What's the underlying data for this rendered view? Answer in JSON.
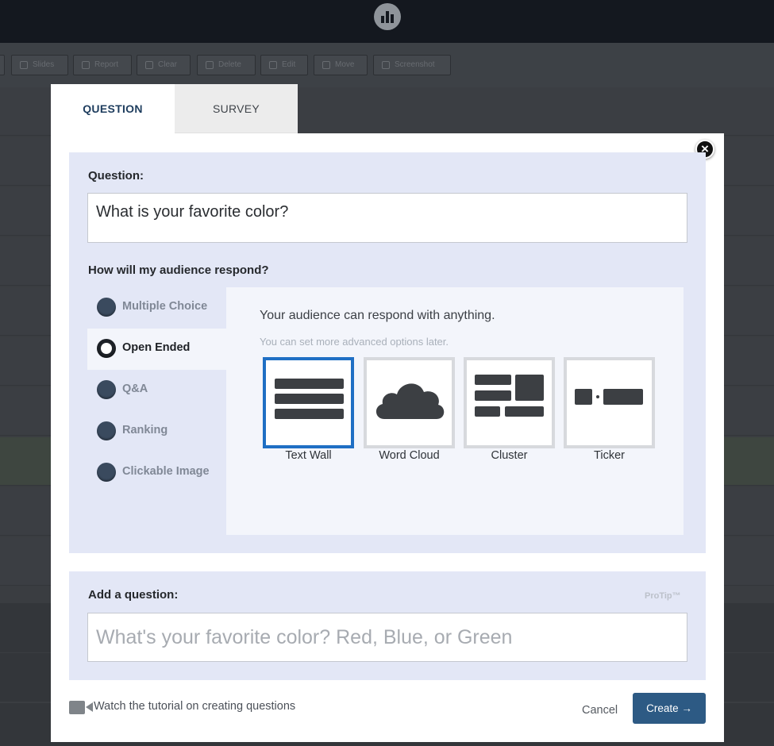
{
  "toolbar": {
    "buttons": [
      {
        "label": "Slides",
        "icon": "link-icon"
      },
      {
        "label": "Report",
        "icon": "report-icon"
      },
      {
        "label": "Clear",
        "icon": "clear-icon"
      },
      {
        "label": "Delete",
        "icon": "trash-icon"
      },
      {
        "label": "Edit",
        "icon": "pencil-icon"
      },
      {
        "label": "Move",
        "icon": "move-icon"
      },
      {
        "label": "Screenshot",
        "icon": "camera-icon"
      }
    ]
  },
  "modal": {
    "tabs": [
      {
        "label": "QUESTION",
        "active": true
      },
      {
        "label": "SURVEY",
        "active": false
      }
    ],
    "close_icon": "×",
    "question": {
      "label": "Question:",
      "value": "What is your favorite color?"
    },
    "respond": {
      "label": "How will my audience respond?",
      "types": [
        {
          "label": "Multiple Choice",
          "selected": false
        },
        {
          "label": "Open Ended",
          "selected": true
        },
        {
          "label": "Q&A",
          "selected": false
        },
        {
          "label": "Ranking",
          "selected": false
        },
        {
          "label": "Clickable Image",
          "selected": false
        }
      ],
      "headline": "Your audience can respond with anything.",
      "subline": "You can set more advanced options later.",
      "visualizations": [
        {
          "label": "Text Wall",
          "icon": "text-wall-icon",
          "selected": true
        },
        {
          "label": "Word Cloud",
          "icon": "cloud-icon",
          "selected": false
        },
        {
          "label": "Cluster",
          "icon": "cluster-icon",
          "selected": false
        },
        {
          "label": "Ticker",
          "icon": "ticker-icon",
          "selected": false
        }
      ]
    },
    "add_question": {
      "label": "Add a question:",
      "protip": "ProTip™",
      "placeholder": "What's your favorite color? Red, Blue, or Green"
    },
    "footer": {
      "tutorial": "Watch the tutorial on creating questions",
      "cancel": "Cancel",
      "create": "Create →"
    }
  },
  "colors": {
    "panel": "#e3e7f6",
    "accent": "#2d5a84",
    "selected_border": "#1f6fc4"
  }
}
